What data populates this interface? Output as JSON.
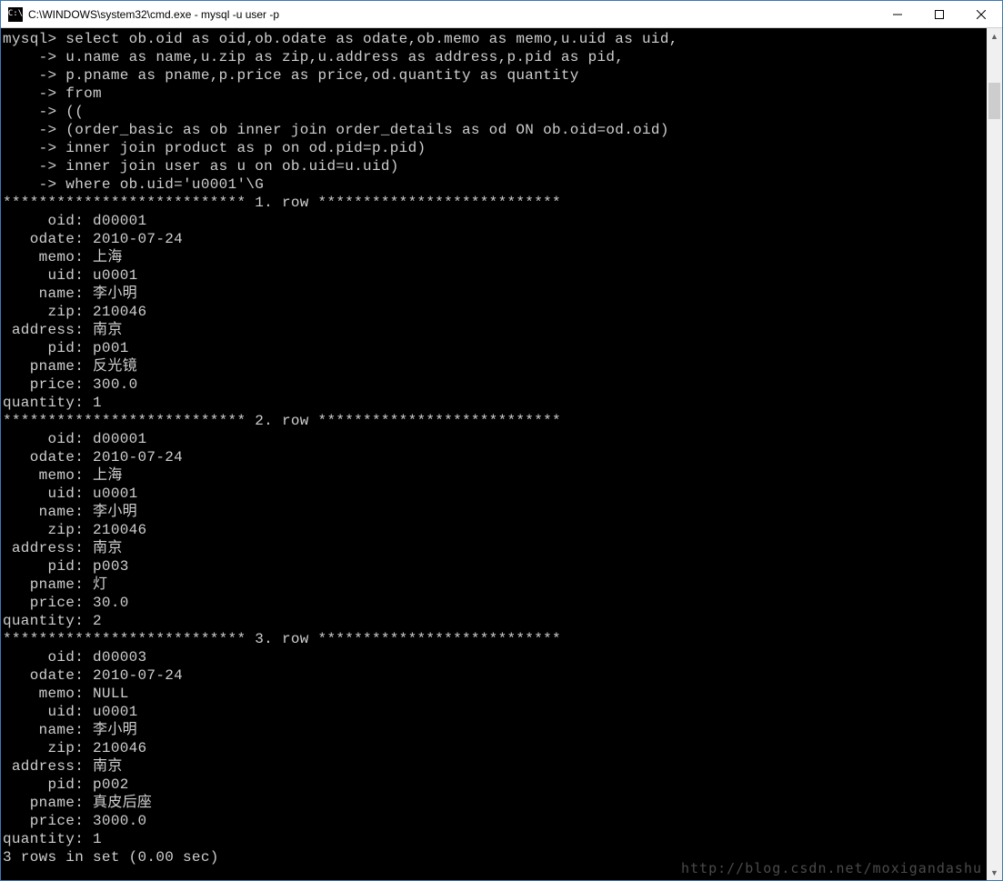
{
  "window": {
    "title": "C:\\WINDOWS\\system32\\cmd.exe - mysql  -u user -p"
  },
  "prompt": "mysql>",
  "cont": "    ->",
  "query_lines": [
    "select ob.oid as oid,ob.odate as odate,ob.memo as memo,u.uid as uid,",
    "u.name as name,u.zip as zip,u.address as address,p.pid as pid,",
    "p.pname as pname,p.price as price,od.quantity as quantity",
    "from",
    "((",
    "(order_basic as ob inner join order_details as od ON ob.oid=od.oid)",
    "inner join product as p on od.pid=p.pid)",
    "inner join user as u on ob.uid=u.uid)",
    "where ob.uid='u0001'\\G"
  ],
  "row_sep_prefix": "***************************",
  "row_sep_suffix": "***************************",
  "row_label": "row",
  "field_order": [
    "oid",
    "odate",
    "memo",
    "uid",
    "name",
    "zip",
    "address",
    "pid",
    "pname",
    "price",
    "quantity"
  ],
  "rows": [
    {
      "n": 1,
      "oid": "d00001",
      "odate": "2010-07-24",
      "memo": "上海",
      "uid": "u0001",
      "name": "李小明",
      "zip": "210046",
      "address": "南京",
      "pid": "p001",
      "pname": "反光镜",
      "price": "300.0",
      "quantity": "1"
    },
    {
      "n": 2,
      "oid": "d00001",
      "odate": "2010-07-24",
      "memo": "上海",
      "uid": "u0001",
      "name": "李小明",
      "zip": "210046",
      "address": "南京",
      "pid": "p003",
      "pname": "灯",
      "price": "30.0",
      "quantity": "2"
    },
    {
      "n": 3,
      "oid": "d00003",
      "odate": "2010-07-24",
      "memo": "NULL",
      "uid": "u0001",
      "name": "李小明",
      "zip": "210046",
      "address": "南京",
      "pid": "p002",
      "pname": "真皮后座",
      "price": "3000.0",
      "quantity": "1"
    }
  ],
  "footer": "3 rows in set (0.00 sec)",
  "watermark": "http://blog.csdn.net/moxigandashu"
}
